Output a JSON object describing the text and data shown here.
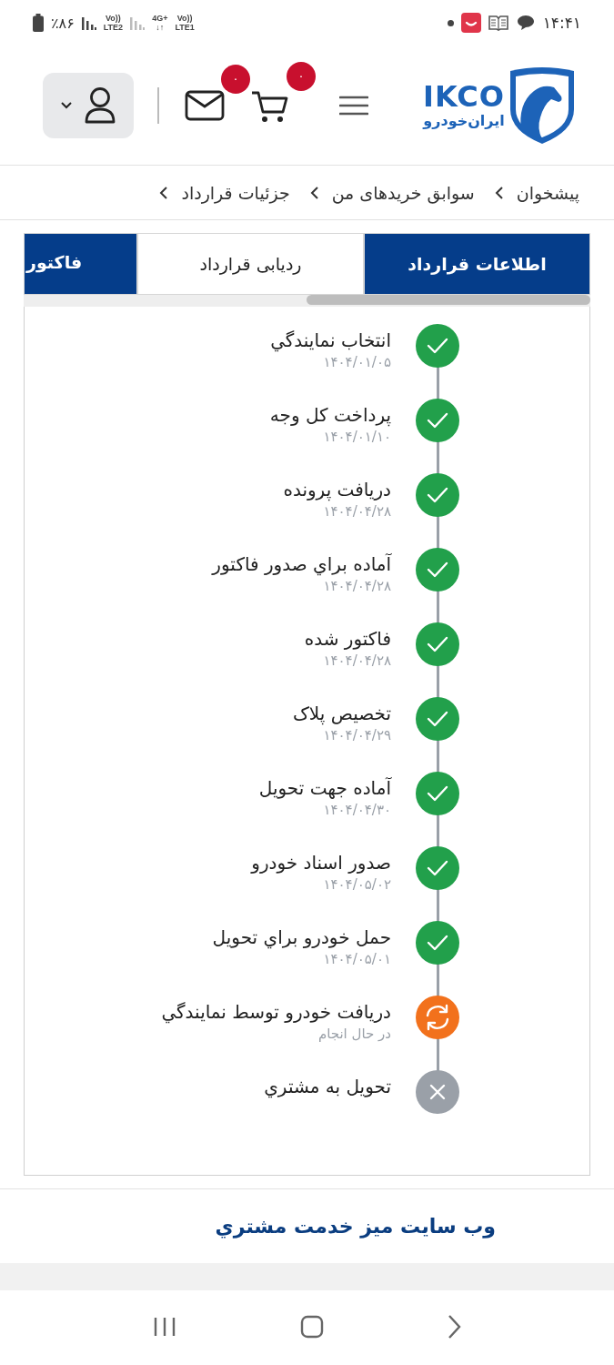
{
  "status_bar": {
    "time": "۱۴:۴۱",
    "battery": "٪۸۶",
    "sim2": {
      "top": "Vo))",
      "bottom": "LTE2"
    },
    "network": {
      "top": "4G+",
      "bottom": "↓↑"
    },
    "sim1": {
      "top": "Vo))",
      "bottom": "LTE1"
    }
  },
  "header": {
    "logo": {
      "latin": "IKCO",
      "persian": "ایران‌خودرو"
    },
    "cart_badge": "۰",
    "mail_badge": "۰"
  },
  "breadcrumb": [
    "پیشخوان",
    "سوابق خریدهای من",
    "جزئیات قرارداد"
  ],
  "tabs": [
    {
      "label": "اطلاعات قرارداد",
      "selected": false
    },
    {
      "label": "ردیابی قرارداد",
      "selected": true
    },
    {
      "label": "فاکتور",
      "selected": false
    }
  ],
  "steps": [
    {
      "title": "انتخاب نمايندگي",
      "subtitle": "۱۴۰۴/۰۱/۰۵",
      "kind": "done"
    },
    {
      "title": "پرداخت کل وجه",
      "subtitle": "۱۴۰۴/۰۱/۱۰",
      "kind": "done"
    },
    {
      "title": "دريافت پرونده",
      "subtitle": "۱۴۰۴/۰۴/۲۸",
      "kind": "done"
    },
    {
      "title": "آماده براي صدور فاکتور",
      "subtitle": "۱۴۰۴/۰۴/۲۸",
      "kind": "done"
    },
    {
      "title": "فاکتور شده",
      "subtitle": "۱۴۰۴/۰۴/۲۸",
      "kind": "done"
    },
    {
      "title": "تخصيص پلاک",
      "subtitle": "۱۴۰۴/۰۴/۲۹",
      "kind": "done"
    },
    {
      "title": "آماده جهت تحويل",
      "subtitle": "۱۴۰۴/۰۴/۳۰",
      "kind": "done"
    },
    {
      "title": "صدور اسناد خودرو",
      "subtitle": "۱۴۰۴/۰۵/۰۲",
      "kind": "done"
    },
    {
      "title": "حمل خودرو براي تحويل",
      "subtitle": "۱۴۰۴/۰۵/۰۱",
      "kind": "done"
    },
    {
      "title": "دريافت خودرو توسط نمايندگي",
      "subtitle": "در حال انجام",
      "kind": "in_progress"
    },
    {
      "title": "تحويل به مشتري",
      "kind": "pending"
    }
  ],
  "footer_link": "وب سايت ميز خدمت مشتري"
}
